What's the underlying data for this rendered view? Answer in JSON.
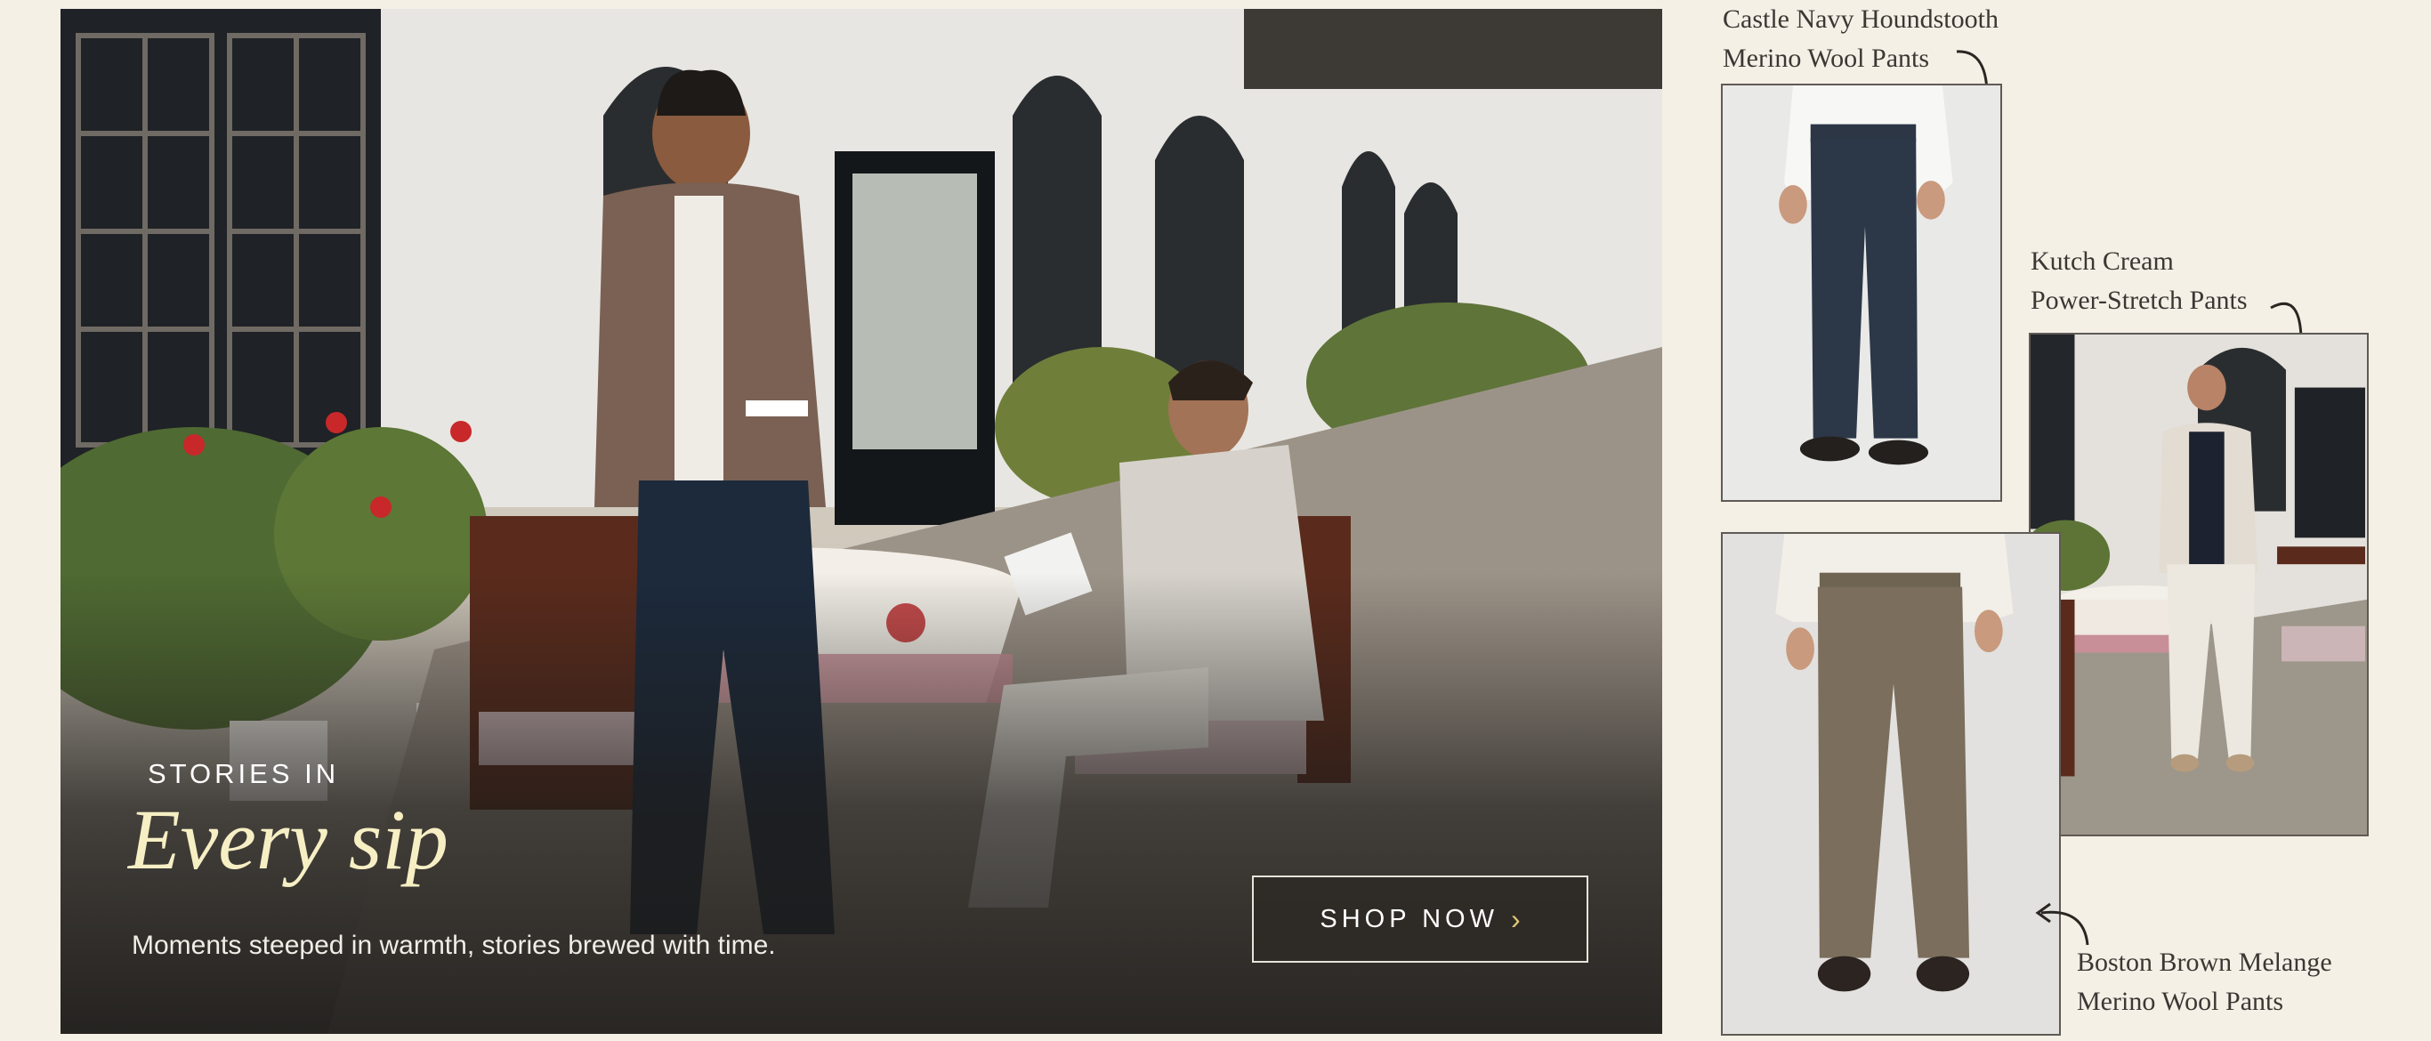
{
  "hero": {
    "eyebrow": "STORIES IN",
    "title": "Every sip",
    "subtitle": "Moments steeped in warmth, stories brewed with time.",
    "cta_label": "SHOP NOW",
    "cta_icon": "chevron-right-icon",
    "image": "two-men-at-outdoor-cafe-photo"
  },
  "products": [
    {
      "name_line1": "Castle Navy Houndstooth",
      "name_line2": "Merino Wool Pants",
      "image": "navy-pants-photo"
    },
    {
      "name_line1": "Kutch Cream",
      "name_line2": "Power-Stretch Pants",
      "image": "cream-outfit-cafe-photo"
    },
    {
      "name_line1": "Boston Brown Melange",
      "name_line2": "Merino Wool Pants",
      "image": "brown-pants-photo"
    }
  ],
  "colors": {
    "page_background": "#f5f0e6",
    "hero_title": "#f7efc4",
    "cta_chevron": "#e3c87a",
    "label_text": "#3b3733"
  }
}
